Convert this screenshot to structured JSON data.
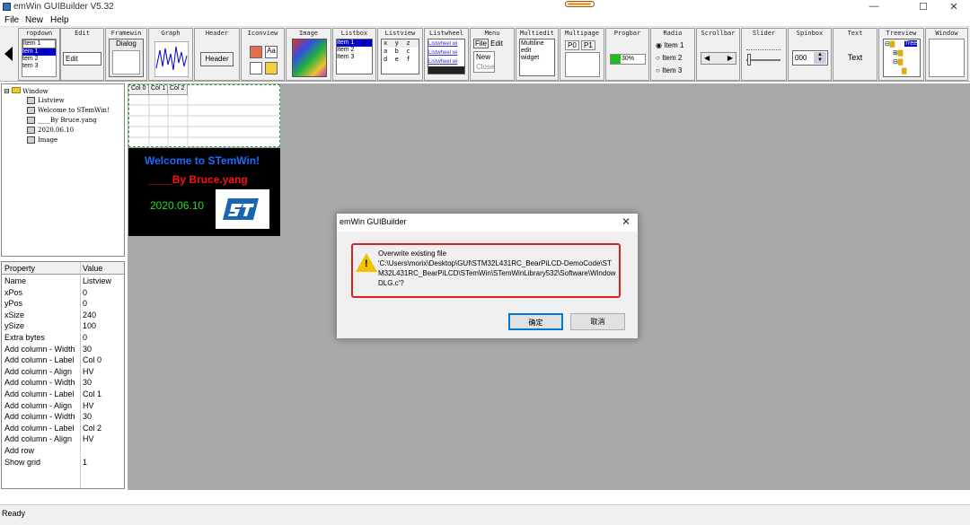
{
  "window": {
    "title": "emWin GUIBuilder V5.32",
    "minimize": "—",
    "maximize": "☐",
    "close": "✕"
  },
  "menu": {
    "file": "File",
    "new": "New",
    "help": "Help"
  },
  "toolbar": {
    "tools": [
      {
        "name": "ropdown"
      },
      {
        "name": "Edit"
      },
      {
        "name": "Framewin"
      },
      {
        "name": "Graph"
      },
      {
        "name": "Header"
      },
      {
        "name": "Iconview"
      },
      {
        "name": "Image"
      },
      {
        "name": "Listbox"
      },
      {
        "name": "Listview"
      },
      {
        "name": "Listwheel"
      },
      {
        "name": "Menu"
      },
      {
        "name": "Multiedit"
      },
      {
        "name": "Multipage"
      },
      {
        "name": "Progbar"
      },
      {
        "name": "Radio"
      },
      {
        "name": "Scrollbar"
      },
      {
        "name": "Slider"
      },
      {
        "name": "Spinbox"
      },
      {
        "name": "Text"
      },
      {
        "name": "Treeview"
      },
      {
        "name": "Window"
      }
    ],
    "dropdown_items": [
      "Item 1",
      "tem 1",
      "tem 2",
      "tem 3"
    ],
    "edit_value": "Edit",
    "framewin_label": "Dialog",
    "header_label": "Header",
    "listbox_items": [
      "Item 1",
      "Item 2",
      "Item 3"
    ],
    "listview_cells": [
      "x",
      "y",
      "z",
      "a",
      "b",
      "c",
      "d",
      "e",
      "f"
    ],
    "listwheel_items": [
      "Listwheel wi",
      "Listwheel wi",
      "Listwheel wi"
    ],
    "menu_items": [
      "File",
      "Edit",
      "New",
      "Close"
    ],
    "multiedit_lines": [
      "Multiline",
      "edit",
      "widget"
    ],
    "multipage_tabs": [
      "P0",
      "P1"
    ],
    "progbar_value": "30%",
    "radio_items": [
      "Item 1",
      "Item 2",
      "Item 3"
    ],
    "spinbox_value": "000",
    "text_label": "Text",
    "treeview_label": "Tree"
  },
  "tree": {
    "root": "Window",
    "children": [
      "Listview",
      "Welcome to STemWin!",
      "____By Bruce.yang",
      "2020.06.10",
      "Image"
    ]
  },
  "properties": {
    "header_property": "Property",
    "header_value": "Value",
    "rows": [
      {
        "k": "Name",
        "v": "Listview"
      },
      {
        "k": "xPos",
        "v": "0"
      },
      {
        "k": "yPos",
        "v": "0"
      },
      {
        "k": "xSize",
        "v": "240"
      },
      {
        "k": "ySize",
        "v": "100"
      },
      {
        "k": "Extra bytes",
        "v": "0"
      },
      {
        "k": "Add column - Width",
        "v": "30"
      },
      {
        "k": "Add column - Label",
        "v": "Col 0"
      },
      {
        "k": "Add column - Align",
        "v": "HV"
      },
      {
        "k": "Add column - Width",
        "v": "30"
      },
      {
        "k": "Add column - Label",
        "v": "Col 1"
      },
      {
        "k": "Add column - Align",
        "v": "HV"
      },
      {
        "k": "Add column - Width",
        "v": "30"
      },
      {
        "k": "Add column - Label",
        "v": "Col 2"
      },
      {
        "k": "Add column - Align",
        "v": "HV"
      },
      {
        "k": "Add row",
        "v": ""
      },
      {
        "k": "Show grid",
        "v": "1"
      }
    ]
  },
  "canvas": {
    "listview_headers": [
      "Col 0",
      "Col 1",
      "Col 2"
    ],
    "welcome_text": "Welcome to STemWin!",
    "author_text": "____By Bruce.yang",
    "date_text": "2020.06.10",
    "welcome_color": "#1a6cff",
    "author_color": "#ff1010",
    "date_color": "#22dd22"
  },
  "dialog": {
    "title": "emWin GUIBuilder",
    "close": "✕",
    "message_line1": "Overwrite existing file",
    "message_path": "'C:\\Users\\morix\\Desktop\\GUI\\STM32L431RC_BearPiLCD-DemoCode\\STM32L431RC_BearPiLCD\\STemWin\\STemWinLibrary532\\Software\\WindowDLG.c'?",
    "ok_button": "确定",
    "cancel_button": "取消"
  },
  "status": {
    "text": "Ready"
  }
}
